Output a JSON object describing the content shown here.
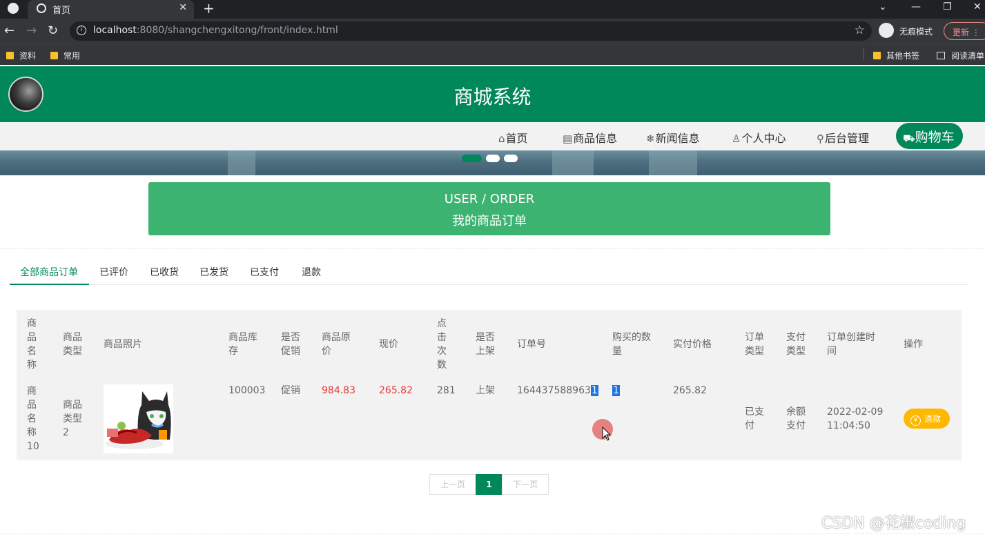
{
  "browser": {
    "tab_title": "首页",
    "tab_close": "✕",
    "new_tab": "+",
    "url_host": "localhost",
    "url_rest": ":8080/shangchengxitong/front/index.html",
    "incognito_label": "无痕模式",
    "update_label": "更新",
    "bookmarks": [
      "资料",
      "常用"
    ],
    "other_bookmarks": "其他书签",
    "reading_list": "阅读清单"
  },
  "site": {
    "title": "商城系统",
    "nav": [
      {
        "icon": "⌂",
        "label": "首页"
      },
      {
        "icon": "▤",
        "label": "商品信息"
      },
      {
        "icon": "❄",
        "label": "新闻信息"
      },
      {
        "icon": "♙",
        "label": "个人中心"
      },
      {
        "icon": "⚲",
        "label": "后台管理"
      }
    ],
    "cart": {
      "icon": "🛒",
      "label": "购物车"
    }
  },
  "section": {
    "title_en": "USER / ORDER",
    "title_cn": "我的商品订单"
  },
  "order_tabs": [
    "全部商品订单",
    "已评价",
    "已收货",
    "已发货",
    "已支付",
    "退款"
  ],
  "table": {
    "headers": {
      "name": "商品名称",
      "type": "商品类型",
      "photo": "商品照片",
      "stock": "商品库存",
      "promo": "是否促销",
      "orig_price": "商品原价",
      "price": "现价",
      "clicks": "点击次数",
      "listed": "是否上架",
      "order_no": "订单号",
      "qty": "购买的数量",
      "paid": "实付价格",
      "order_type": "订单类型",
      "pay_type": "支付类型",
      "created": "订单创建时间",
      "action": "操作"
    },
    "row": {
      "name": "商品名称10",
      "type": "商品类型2",
      "stock": "100003",
      "promo": "促销",
      "orig_price": "984.83",
      "price": "265.82",
      "clicks": "281",
      "listed": "上架",
      "order_no_main": "164437588963",
      "order_no_hl": "1",
      "qty": "1",
      "paid": "265.82",
      "order_type": "已支付",
      "pay_type": "余额支付",
      "created_date": "2022-02-09",
      "created_time": "11:04:50",
      "action_label": "退款"
    }
  },
  "pagination": {
    "prev": "上一页",
    "current": "1",
    "next": "下一页"
  },
  "watermark": "CSDN @花椒coding",
  "colors": {
    "brand": "#00875a",
    "title_box": "#3cb371",
    "price_red": "#e53935",
    "refund": "#ffb800"
  }
}
